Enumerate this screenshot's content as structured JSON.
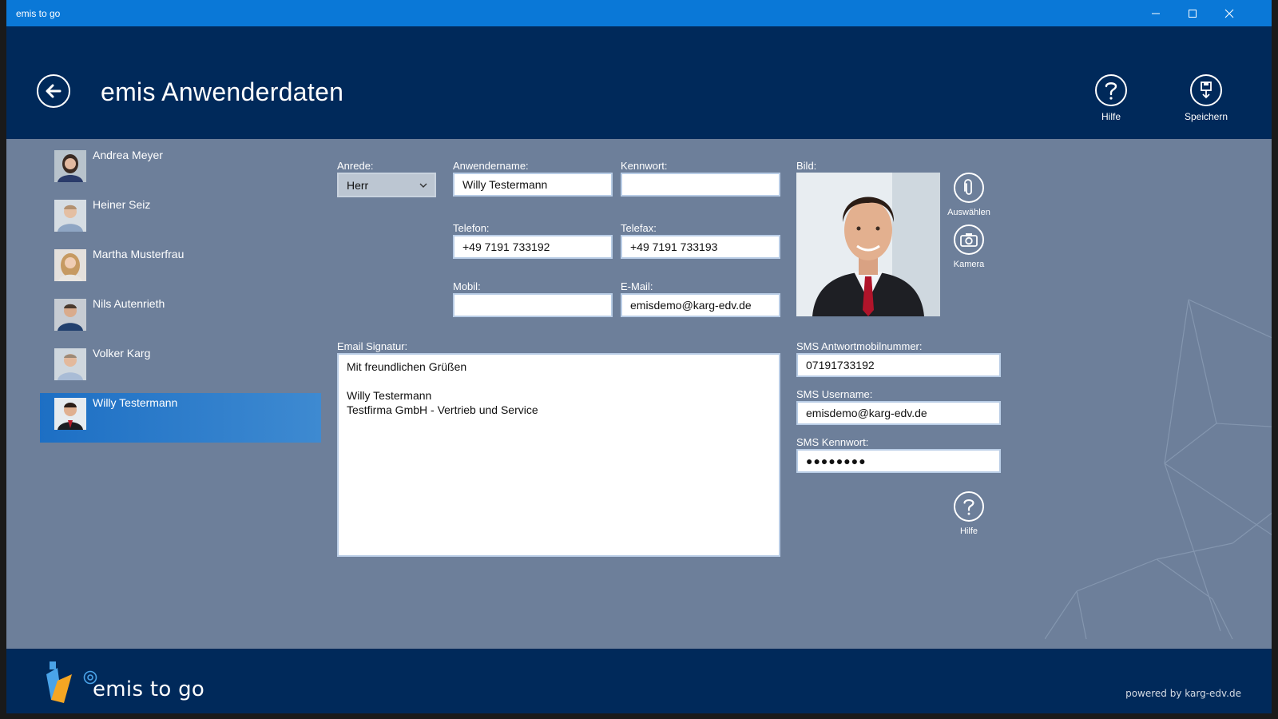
{
  "window": {
    "title": "emis to go"
  },
  "header": {
    "title": "emis Anwenderdaten",
    "help_label": "Hilfe",
    "save_label": "Speichern"
  },
  "users": [
    {
      "name": "Andrea Meyer"
    },
    {
      "name": "Heiner Seiz"
    },
    {
      "name": "Martha Musterfrau"
    },
    {
      "name": "Nils Autenrieth"
    },
    {
      "name": "Volker Karg"
    },
    {
      "name": "Willy Testermann",
      "selected": true
    }
  ],
  "form": {
    "anrede_label": "Anrede:",
    "anrede_value": "Herr",
    "username_label": "Anwendername:",
    "username_value": "Willy Testermann",
    "password_label": "Kennwort:",
    "password_value": "",
    "phone_label": "Telefon:",
    "phone_value": "+49 7191 733192",
    "fax_label": "Telefax:",
    "fax_value": "+49 7191 733193",
    "mobile_label": "Mobil:",
    "mobile_value": "",
    "email_label": "E-Mail:",
    "email_value": "emisdemo@karg-edv.de",
    "signature_label": "Email Signatur:",
    "signature_value": "Mit freundlichen Grüßen\n\nWilly Testermann\nTestfirma GmbH - Vertrieb und Service",
    "picture_label": "Bild:",
    "choose_label": "Auswählen",
    "camera_label": "Kamera",
    "sms_reply_label": "SMS Antwortmobilnummer:",
    "sms_reply_value": "07191733192",
    "sms_user_label": "SMS Username:",
    "sms_user_value": "emisdemo@karg-edv.de",
    "sms_pass_label": "SMS Kennwort:",
    "sms_pass_value": "●●●●●●●●",
    "sms_help_label": "Hilfe"
  },
  "footer": {
    "brand": "emis to go",
    "powered": "powered by karg-edv.de"
  },
  "colors": {
    "titlebar": "#0a78d7",
    "header": "#00295a",
    "content": "#6d7f9a",
    "selected": "#2a7dcb"
  }
}
